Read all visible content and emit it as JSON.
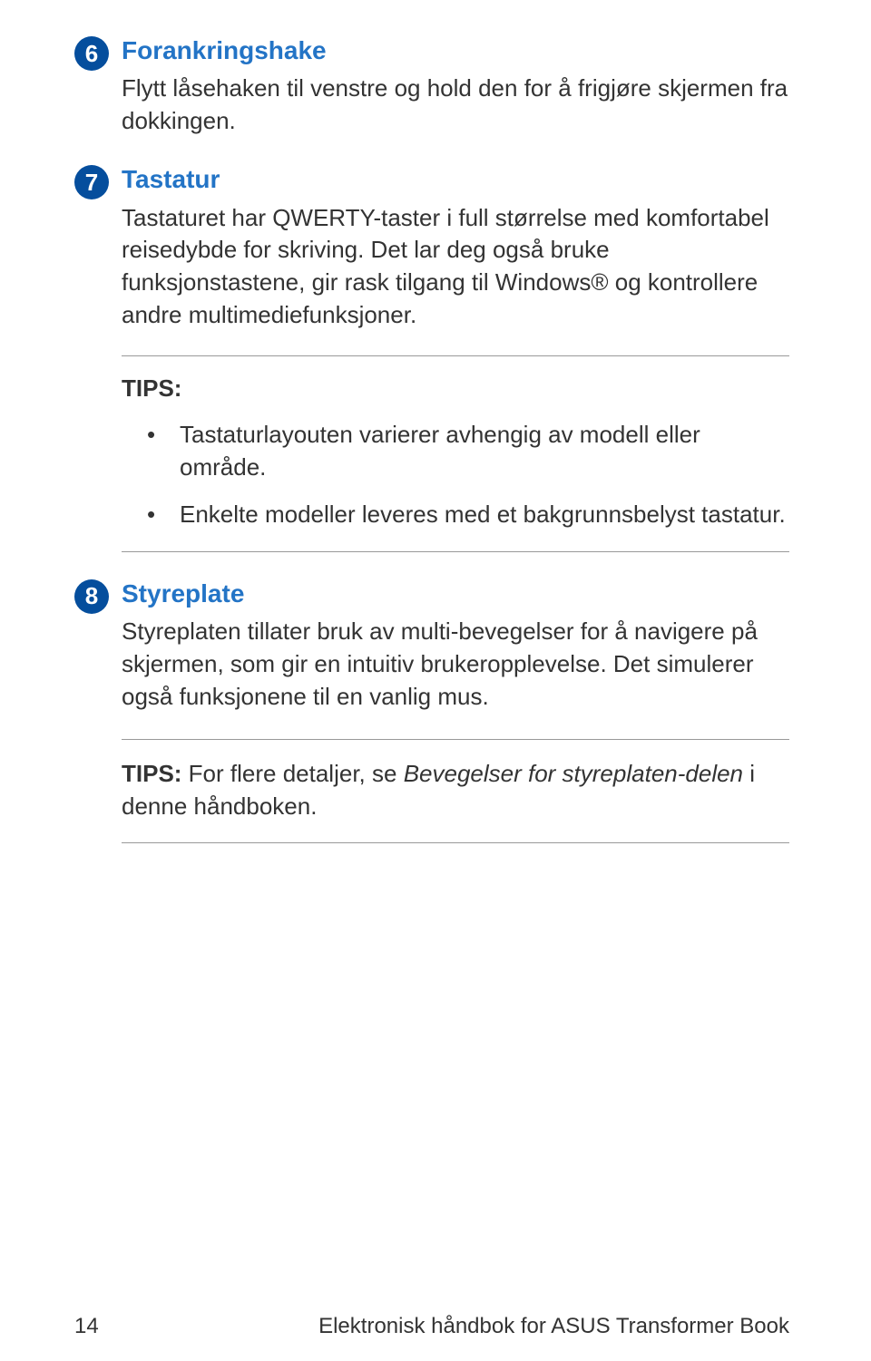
{
  "sections": [
    {
      "num": "6",
      "heading": "Forankringshake",
      "body": "Flytt låsehaken til venstre og hold den for å frigjøre skjermen fra dokkingen."
    },
    {
      "num": "7",
      "heading": "Tastatur",
      "body": "Tastaturet har QWERTY-taster i full størrelse med komfortabel reisedybde for skriving. Det lar deg også bruke funksjonstastene, gir rask tilgang til Windows® og kontrollere andre multimediefunksjoner.",
      "tips_label": "TIPS:",
      "tips": [
        "Tastaturlayouten varierer avhengig av modell eller område.",
        "Enkelte modeller leveres med et bakgrunnsbelyst tastatur."
      ]
    },
    {
      "num": "8",
      "heading": "Styreplate",
      "body": "Styreplaten tillater bruk av multi-bevegelser for å navigere på skjermen, som gir en intuitiv brukeropplevelse. Det simulerer også funksjonene til en vanlig mus.",
      "tips2_label": "TIPS:",
      "tips2_pre": " For flere detaljer, se ",
      "tips2_italic": "Bevegelser for styreplaten-delen",
      "tips2_post": " i denne håndboken."
    }
  ],
  "footer": {
    "page": "14",
    "title": "Elektronisk håndbok for ASUS Transformer Book"
  }
}
